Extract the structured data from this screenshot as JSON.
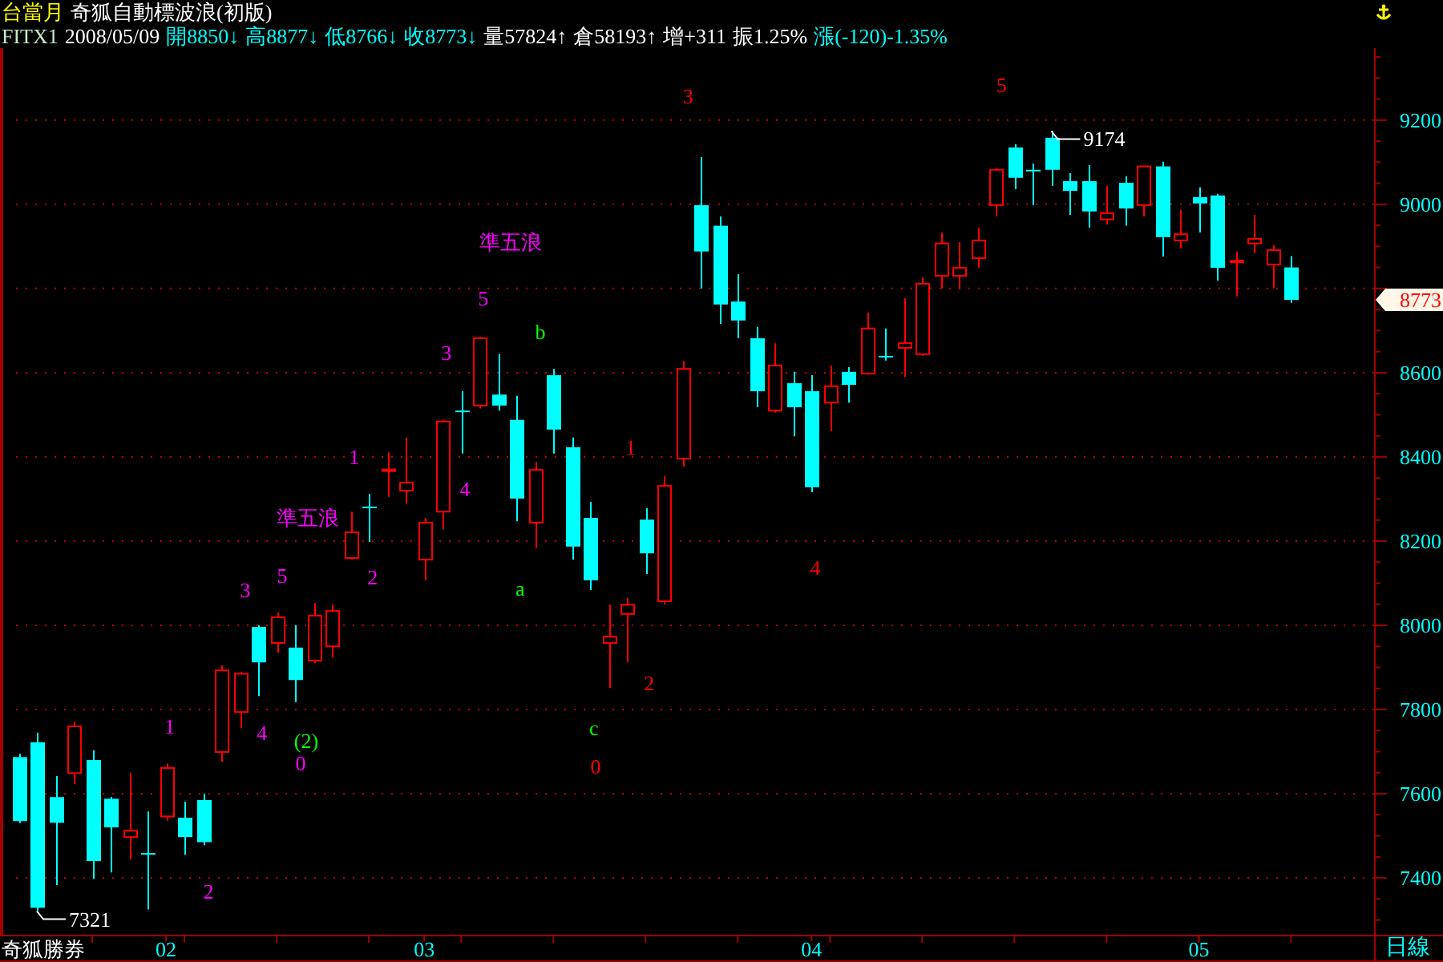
{
  "header": {
    "contract": "台當月",
    "title": "奇狐自動標波浪(初版)",
    "quote": [
      {
        "text": "FITX1",
        "color": "#c8e8c8"
      },
      {
        "text": "2008/05/09",
        "color": "#ffffff"
      },
      {
        "text": "開8850↓",
        "color": "#00ffff"
      },
      {
        "text": "高8877↓",
        "color": "#00ffff"
      },
      {
        "text": "低8766↓",
        "color": "#00ffff"
      },
      {
        "text": "收8773↓",
        "color": "#00ffff"
      },
      {
        "text": "量57824↑",
        "color": "#ffffff"
      },
      {
        "text": "倉58193↑",
        "color": "#ffffff"
      },
      {
        "text": "增+311",
        "color": "#ffffff"
      },
      {
        "text": "振1.25%",
        "color": "#ffffff"
      },
      {
        "text": "漲(-120)-1.35%",
        "color": "#00ffff"
      }
    ]
  },
  "chart": {
    "brand": "奇狐勝券",
    "period": "日線",
    "price_tag": "8773",
    "chart_data": {
      "type": "candlestick",
      "grid": true,
      "ylim": [
        7265,
        9371
      ],
      "yticks": [
        7400,
        7600,
        7800,
        8000,
        8200,
        8400,
        8600,
        9000,
        9200
      ],
      "categories": [
        null,
        null,
        null,
        null,
        null,
        null,
        null,
        null,
        "02",
        null,
        null,
        null,
        null,
        null,
        null,
        null,
        null,
        null,
        null,
        null,
        null,
        null,
        "03",
        null,
        null,
        null,
        null,
        null,
        null,
        null,
        null,
        null,
        null,
        null,
        null,
        null,
        null,
        null,
        null,
        null,
        null,
        null,
        null,
        "04",
        null,
        null,
        null,
        null,
        null,
        null,
        null,
        null,
        null,
        null,
        null,
        null,
        null,
        null,
        null,
        null,
        null,
        null,
        null,
        null,
        "05",
        null,
        null,
        null,
        null,
        null
      ],
      "ohlc": [
        [
          7687,
          7695,
          7530,
          7535
        ],
        [
          7722,
          7745,
          7321,
          7329
        ],
        [
          7592,
          7642,
          7383,
          7531
        ],
        [
          7649,
          7771,
          7623,
          7760
        ],
        [
          7680,
          7703,
          7398,
          7440
        ],
        [
          7588,
          7592,
          7413,
          7520
        ],
        [
          7497,
          7649,
          7444,
          7512
        ],
        [
          7459,
          7558,
          7325,
          7458
        ],
        [
          7546,
          7672,
          7535,
          7661
        ],
        [
          7543,
          7581,
          7455,
          7497
        ],
        [
          7585,
          7600,
          7478,
          7485
        ],
        [
          7699,
          7905,
          7676,
          7893
        ],
        [
          7794,
          7889,
          7756,
          7885
        ],
        [
          7996,
          8000,
          7832,
          7912
        ],
        [
          7958,
          8030,
          7935,
          8019
        ],
        [
          7947,
          8000,
          7817,
          7870
        ],
        [
          7916,
          8053,
          7910,
          8023
        ],
        [
          7950,
          8049,
          7924,
          8034
        ],
        [
          8160,
          8270,
          8156,
          8221
        ],
        [
          8282,
          8312,
          8198,
          8281
        ],
        [
          8369,
          8411,
          8305,
          8370
        ],
        [
          8320,
          8446,
          8289,
          8339
        ],
        [
          8156,
          8255,
          8107,
          8244
        ],
        [
          8270,
          8488,
          8228,
          8484
        ],
        [
          8510,
          8556,
          8408,
          8509
        ],
        [
          8522,
          8686,
          8515,
          8682
        ],
        [
          8548,
          8644,
          8510,
          8522
        ],
        [
          8488,
          8545,
          8247,
          8301
        ],
        [
          8244,
          8388,
          8183,
          8369
        ],
        [
          8594,
          8609,
          8408,
          8465
        ],
        [
          8423,
          8446,
          8156,
          8187
        ],
        [
          8255,
          8293,
          8084,
          8107
        ],
        [
          7958,
          8049,
          7851,
          7973
        ],
        [
          8027,
          8065,
          7912,
          8049
        ],
        [
          8251,
          8278,
          8122,
          8171
        ],
        [
          8057,
          8354,
          8049,
          8331
        ],
        [
          8396,
          8628,
          8377,
          8609
        ],
        [
          8998,
          9112,
          8800,
          8888
        ],
        [
          8949,
          8971,
          8716,
          8762
        ],
        [
          8769,
          8834,
          8682,
          8724
        ],
        [
          8682,
          8709,
          8518,
          8556
        ],
        [
          8510,
          8670,
          8505,
          8617
        ],
        [
          8575,
          8602,
          8449,
          8518
        ],
        [
          8556,
          8594,
          8316,
          8328
        ],
        [
          8529,
          8617,
          8461,
          8568
        ],
        [
          8602,
          8613,
          8529,
          8571
        ],
        [
          8598,
          8743,
          8595,
          8705
        ],
        [
          8640,
          8705,
          8629,
          8639
        ],
        [
          8659,
          8777,
          8590,
          8670
        ],
        [
          8644,
          8827,
          8640,
          8811
        ],
        [
          8830,
          8933,
          8800,
          8907
        ],
        [
          8830,
          8910,
          8798,
          8849
        ],
        [
          8872,
          8945,
          8849,
          8914
        ],
        [
          8998,
          9086,
          8971,
          9082
        ],
        [
          9135,
          9143,
          9036,
          9063
        ],
        [
          9082,
          9097,
          8998,
          9081
        ],
        [
          9158,
          9174,
          9044,
          9082
        ],
        [
          9055,
          9074,
          8975,
          9032
        ],
        [
          9055,
          9093,
          8945,
          8983
        ],
        [
          8964,
          9044,
          8952,
          8979
        ],
        [
          9051,
          9067,
          8949,
          8990
        ],
        [
          8998,
          9092,
          8971,
          9090
        ],
        [
          9090,
          9101,
          8876,
          8922
        ],
        [
          8914,
          8987,
          8895,
          8929
        ],
        [
          9017,
          9040,
          8933,
          9002
        ],
        [
          9021,
          9025,
          8819,
          8849
        ],
        [
          8865,
          8888,
          8781,
          8866
        ],
        [
          8907,
          8975,
          8884,
          8918
        ],
        [
          8857,
          8903,
          8800,
          8891
        ],
        [
          8850,
          8877,
          8766,
          8773
        ]
      ],
      "annotations": [
        "7321",
        "9174",
        "1",
        "2",
        "3",
        "4",
        "5",
        "(2)",
        "0",
        "準五浪",
        "1",
        "2",
        "3",
        "4",
        "5",
        "準五浪",
        "b",
        "a",
        "1",
        "2",
        "c",
        "0",
        "3",
        "4",
        "5"
      ]
    },
    "annotation_styles": [
      {
        "kind": "extreme"
      },
      {
        "kind": "extreme"
      },
      {
        "kind": "wave",
        "color": "#ff00ff"
      },
      {
        "kind": "wave",
        "color": "#ff00ff"
      },
      {
        "kind": "wave",
        "color": "#ff00ff"
      },
      {
        "kind": "wave",
        "color": "#ff00ff"
      },
      {
        "kind": "wave",
        "color": "#ff00ff"
      },
      {
        "kind": "wave",
        "color": "#00ff00"
      },
      {
        "kind": "wave",
        "color": "#ff00ff"
      },
      {
        "kind": "wave",
        "color": "#ff00ff"
      },
      {
        "kind": "wave",
        "color": "#ff00ff"
      },
      {
        "kind": "wave",
        "color": "#ff00ff"
      },
      {
        "kind": "wave",
        "color": "#ff00ff"
      },
      {
        "kind": "wave",
        "color": "#ff00ff"
      },
      {
        "kind": "wave",
        "color": "#ff00ff"
      },
      {
        "kind": "wave",
        "color": "#ff00ff"
      },
      {
        "kind": "wave",
        "color": "#00ff00"
      },
      {
        "kind": "wave",
        "color": "#00ff00"
      },
      {
        "kind": "wave",
        "color": "#ff0000"
      },
      {
        "kind": "wave",
        "color": "#ff0000"
      },
      {
        "kind": "wave",
        "color": "#00ff00"
      },
      {
        "kind": "wave",
        "color": "#ff0000"
      },
      {
        "kind": "wave",
        "color": "#ff0000"
      },
      {
        "kind": "wave",
        "color": "#ff0000"
      },
      {
        "kind": "wave",
        "color": "#ff0000"
      }
    ]
  }
}
